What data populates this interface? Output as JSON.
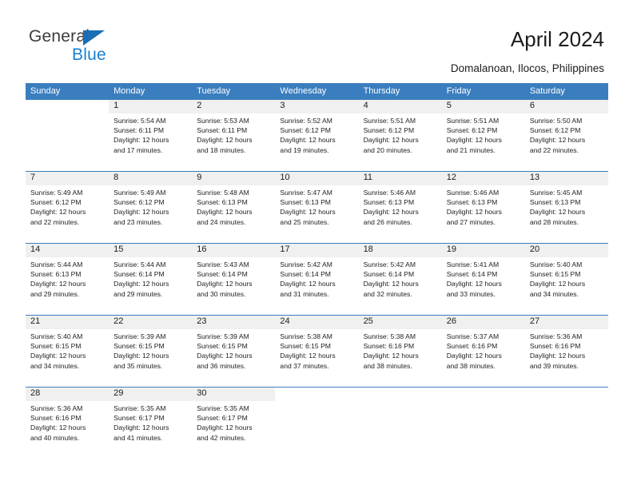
{
  "brand": {
    "name_top": "General",
    "name_bottom": "Blue",
    "color_top": "#3c3c3c",
    "color_bottom": "#1a7fd4",
    "triangle_color": "#1a6fb4"
  },
  "header": {
    "title": "April 2024",
    "subtitle": "Domalanoan, Ilocos, Philippines"
  },
  "theme": {
    "header_bg": "#3b7ebf",
    "header_text": "#ffffff",
    "daynum_band_bg": "#f0f0f0",
    "row_divider": "#3b7ebf",
    "text": "#222222"
  },
  "weekdays": [
    "Sunday",
    "Monday",
    "Tuesday",
    "Wednesday",
    "Thursday",
    "Friday",
    "Saturday"
  ],
  "weeks": [
    {
      "filled_count": 6,
      "days": [
        {
          "day": "",
          "lines": []
        },
        {
          "day": "1",
          "lines": [
            "Sunrise: 5:54 AM",
            "Sunset: 6:11 PM",
            "Daylight: 12 hours",
            "and 17 minutes."
          ]
        },
        {
          "day": "2",
          "lines": [
            "Sunrise: 5:53 AM",
            "Sunset: 6:11 PM",
            "Daylight: 12 hours",
            "and 18 minutes."
          ]
        },
        {
          "day": "3",
          "lines": [
            "Sunrise: 5:52 AM",
            "Sunset: 6:12 PM",
            "Daylight: 12 hours",
            "and 19 minutes."
          ]
        },
        {
          "day": "4",
          "lines": [
            "Sunrise: 5:51 AM",
            "Sunset: 6:12 PM",
            "Daylight: 12 hours",
            "and 20 minutes."
          ]
        },
        {
          "day": "5",
          "lines": [
            "Sunrise: 5:51 AM",
            "Sunset: 6:12 PM",
            "Daylight: 12 hours",
            "and 21 minutes."
          ]
        },
        {
          "day": "6",
          "lines": [
            "Sunrise: 5:50 AM",
            "Sunset: 6:12 PM",
            "Daylight: 12 hours",
            "and 22 minutes."
          ]
        }
      ]
    },
    {
      "filled_count": 7,
      "days": [
        {
          "day": "7",
          "lines": [
            "Sunrise: 5:49 AM",
            "Sunset: 6:12 PM",
            "Daylight: 12 hours",
            "and 22 minutes."
          ]
        },
        {
          "day": "8",
          "lines": [
            "Sunrise: 5:49 AM",
            "Sunset: 6:12 PM",
            "Daylight: 12 hours",
            "and 23 minutes."
          ]
        },
        {
          "day": "9",
          "lines": [
            "Sunrise: 5:48 AM",
            "Sunset: 6:13 PM",
            "Daylight: 12 hours",
            "and 24 minutes."
          ]
        },
        {
          "day": "10",
          "lines": [
            "Sunrise: 5:47 AM",
            "Sunset: 6:13 PM",
            "Daylight: 12 hours",
            "and 25 minutes."
          ]
        },
        {
          "day": "11",
          "lines": [
            "Sunrise: 5:46 AM",
            "Sunset: 6:13 PM",
            "Daylight: 12 hours",
            "and 26 minutes."
          ]
        },
        {
          "day": "12",
          "lines": [
            "Sunrise: 5:46 AM",
            "Sunset: 6:13 PM",
            "Daylight: 12 hours",
            "and 27 minutes."
          ]
        },
        {
          "day": "13",
          "lines": [
            "Sunrise: 5:45 AM",
            "Sunset: 6:13 PM",
            "Daylight: 12 hours",
            "and 28 minutes."
          ]
        }
      ]
    },
    {
      "filled_count": 7,
      "days": [
        {
          "day": "14",
          "lines": [
            "Sunrise: 5:44 AM",
            "Sunset: 6:13 PM",
            "Daylight: 12 hours",
            "and 29 minutes."
          ]
        },
        {
          "day": "15",
          "lines": [
            "Sunrise: 5:44 AM",
            "Sunset: 6:14 PM",
            "Daylight: 12 hours",
            "and 29 minutes."
          ]
        },
        {
          "day": "16",
          "lines": [
            "Sunrise: 5:43 AM",
            "Sunset: 6:14 PM",
            "Daylight: 12 hours",
            "and 30 minutes."
          ]
        },
        {
          "day": "17",
          "lines": [
            "Sunrise: 5:42 AM",
            "Sunset: 6:14 PM",
            "Daylight: 12 hours",
            "and 31 minutes."
          ]
        },
        {
          "day": "18",
          "lines": [
            "Sunrise: 5:42 AM",
            "Sunset: 6:14 PM",
            "Daylight: 12 hours",
            "and 32 minutes."
          ]
        },
        {
          "day": "19",
          "lines": [
            "Sunrise: 5:41 AM",
            "Sunset: 6:14 PM",
            "Daylight: 12 hours",
            "and 33 minutes."
          ]
        },
        {
          "day": "20",
          "lines": [
            "Sunrise: 5:40 AM",
            "Sunset: 6:15 PM",
            "Daylight: 12 hours",
            "and 34 minutes."
          ]
        }
      ]
    },
    {
      "filled_count": 7,
      "days": [
        {
          "day": "21",
          "lines": [
            "Sunrise: 5:40 AM",
            "Sunset: 6:15 PM",
            "Daylight: 12 hours",
            "and 34 minutes."
          ]
        },
        {
          "day": "22",
          "lines": [
            "Sunrise: 5:39 AM",
            "Sunset: 6:15 PM",
            "Daylight: 12 hours",
            "and 35 minutes."
          ]
        },
        {
          "day": "23",
          "lines": [
            "Sunrise: 5:39 AM",
            "Sunset: 6:15 PM",
            "Daylight: 12 hours",
            "and 36 minutes."
          ]
        },
        {
          "day": "24",
          "lines": [
            "Sunrise: 5:38 AM",
            "Sunset: 6:15 PM",
            "Daylight: 12 hours",
            "and 37 minutes."
          ]
        },
        {
          "day": "25",
          "lines": [
            "Sunrise: 5:38 AM",
            "Sunset: 6:16 PM",
            "Daylight: 12 hours",
            "and 38 minutes."
          ]
        },
        {
          "day": "26",
          "lines": [
            "Sunrise: 5:37 AM",
            "Sunset: 6:16 PM",
            "Daylight: 12 hours",
            "and 38 minutes."
          ]
        },
        {
          "day": "27",
          "lines": [
            "Sunrise: 5:36 AM",
            "Sunset: 6:16 PM",
            "Daylight: 12 hours",
            "and 39 minutes."
          ]
        }
      ]
    },
    {
      "filled_count": 3,
      "days": [
        {
          "day": "28",
          "lines": [
            "Sunrise: 5:36 AM",
            "Sunset: 6:16 PM",
            "Daylight: 12 hours",
            "and 40 minutes."
          ]
        },
        {
          "day": "29",
          "lines": [
            "Sunrise: 5:35 AM",
            "Sunset: 6:17 PM",
            "Daylight: 12 hours",
            "and 41 minutes."
          ]
        },
        {
          "day": "30",
          "lines": [
            "Sunrise: 5:35 AM",
            "Sunset: 6:17 PM",
            "Daylight: 12 hours",
            "and 42 minutes."
          ]
        },
        {
          "day": "",
          "lines": []
        },
        {
          "day": "",
          "lines": []
        },
        {
          "day": "",
          "lines": []
        },
        {
          "day": "",
          "lines": []
        }
      ]
    }
  ]
}
